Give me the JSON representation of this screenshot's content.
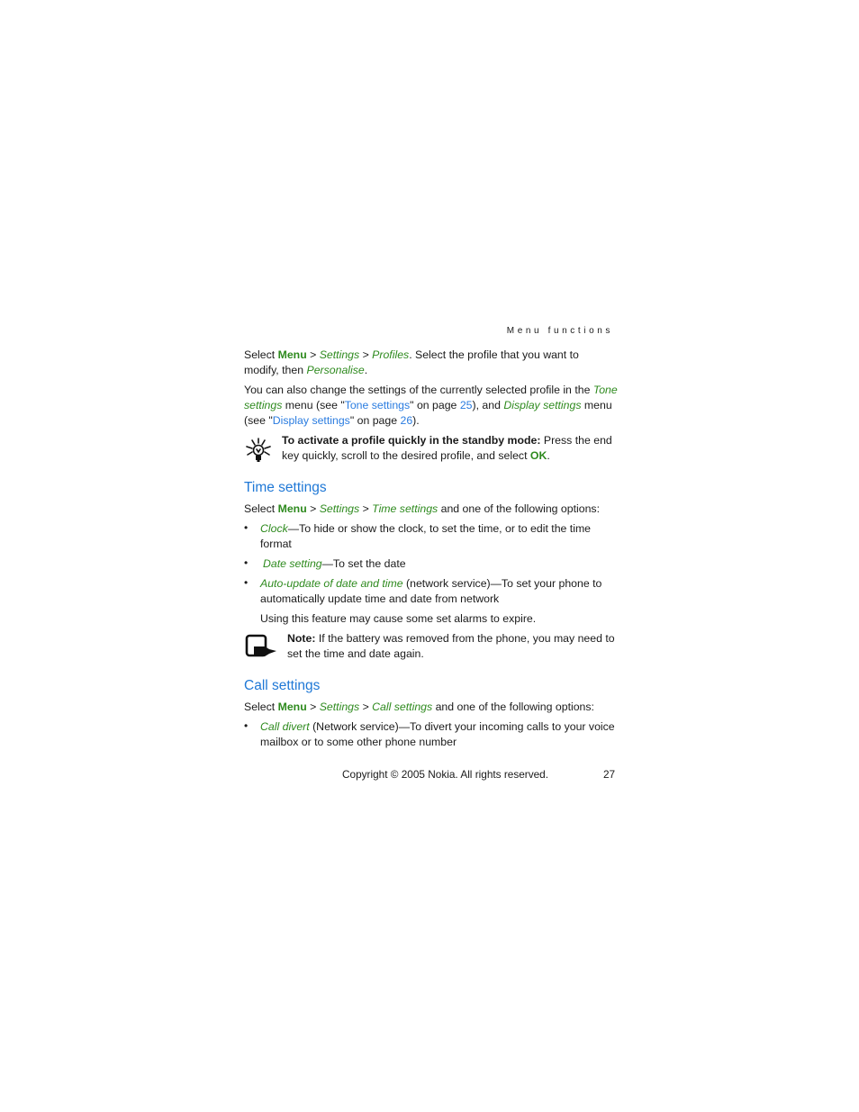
{
  "header": {
    "section": "Menu functions"
  },
  "intro": {
    "p1": {
      "select": "Select ",
      "menu": "Menu",
      "sep": " > ",
      "settings": "Settings",
      "profiles": "Profiles",
      "rest1": ". Select the profile that you want to",
      "line2": "modify, then ",
      "personalise": "Personalise",
      "end": "."
    },
    "p2": {
      "l1": "You can also change the settings of the currently selected profile in the ",
      "tone": "Tone",
      "settings_word": "settings",
      "l2a": " menu (see \"",
      "tone_link": "Tone settings",
      "l2b": "\" on page ",
      "page25": "25",
      "l2c": "), and ",
      "display": "Display settings",
      "l2d": " menu",
      "l3a": "(see \"",
      "display_link": "Display settings",
      "l3b": "\" on page ",
      "page26": "26",
      "l3c": ")."
    },
    "tip": {
      "icon": "lightbulb-icon",
      "bold": "To activate a profile quickly in the standby mode:",
      "rest": " Press the end",
      "line2": "key quickly, scroll to the desired profile, and select ",
      "ok": "OK",
      "end": "."
    }
  },
  "time_settings": {
    "title": "Time settings",
    "select": "Select ",
    "menu": "Menu",
    "sep": " > ",
    "settings": "Settings",
    "item": "Time settings",
    "rest": " and one of the following options:",
    "bullets": [
      {
        "term": "Clock",
        "text": "—To hide or show the clock, to set the time, or to edit the time",
        "line2": "format"
      },
      {
        "term": "Date setting",
        "text": "—To set the date"
      },
      {
        "term": "Auto-update of date and time",
        "text": " (network service)—To set your phone to",
        "line2": "automatically update time and date from network",
        "extra": "Using this feature may cause some set alarms to expire."
      }
    ],
    "note": {
      "icon": "note-icon",
      "bold": "Note:",
      "rest": " If the battery was removed from the phone, you may need to",
      "line2": "set the time and date again."
    }
  },
  "call_settings": {
    "title": "Call settings",
    "select": "Select ",
    "menu": "Menu",
    "sep": " > ",
    "settings": "Settings",
    "item": "Call settings",
    "rest": " and one of the following options:",
    "bullets": [
      {
        "term": "Call divert",
        "text": " (Network service)—To divert your incoming calls to your voice",
        "line2": "mailbox or to some other phone number"
      }
    ]
  },
  "footer": {
    "copyright": "Copyright © 2005 Nokia. All rights reserved.",
    "page": "27"
  }
}
